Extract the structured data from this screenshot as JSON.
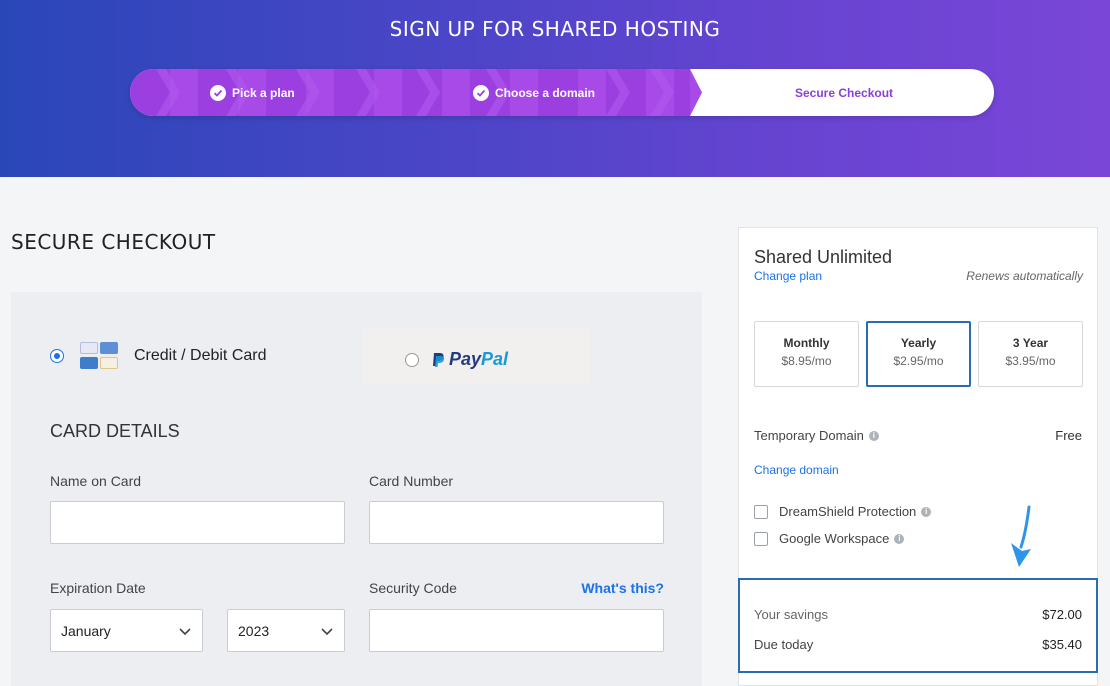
{
  "header": {
    "title": "SIGN UP FOR SHARED HOSTING",
    "steps": [
      {
        "label": "Pick a plan",
        "state": "done"
      },
      {
        "label": "Choose a domain",
        "state": "done"
      },
      {
        "label": "Secure Checkout",
        "state": "current"
      }
    ]
  },
  "checkout": {
    "heading": "SECURE CHECKOUT",
    "payment_methods": {
      "card_label": "Credit / Debit Card",
      "paypal_pay": "Pay",
      "paypal_pal": "Pal"
    },
    "card_details": {
      "title": "CARD DETAILS",
      "name_label": "Name on Card",
      "number_label": "Card Number",
      "expiration_label": "Expiration Date",
      "expiration_month": "January",
      "expiration_year": "2023",
      "security_label": "Security Code",
      "whats_this": "What's this?"
    }
  },
  "summary": {
    "plan_name": "Shared Unlimited",
    "change_plan": "Change plan",
    "renews": "Renews automatically",
    "terms": [
      {
        "name": "Monthly",
        "price": "$8.95/mo"
      },
      {
        "name": "Yearly",
        "price": "$2.95/mo"
      },
      {
        "name": "3 Year",
        "price": "$3.95/mo"
      }
    ],
    "temporary_domain_label": "Temporary Domain",
    "temporary_domain_value": "Free",
    "change_domain": "Change domain",
    "addons": [
      {
        "label": "DreamShield Protection"
      },
      {
        "label": "Google Workspace"
      }
    ],
    "savings_label": "Your savings",
    "savings_value": "$72.00",
    "due_label": "Due today",
    "due_value": "$35.40"
  },
  "colors": {
    "accent": "#1a73e8",
    "stepper_purple": "#9b3fe0",
    "selected_border": "#2a6bb5"
  }
}
